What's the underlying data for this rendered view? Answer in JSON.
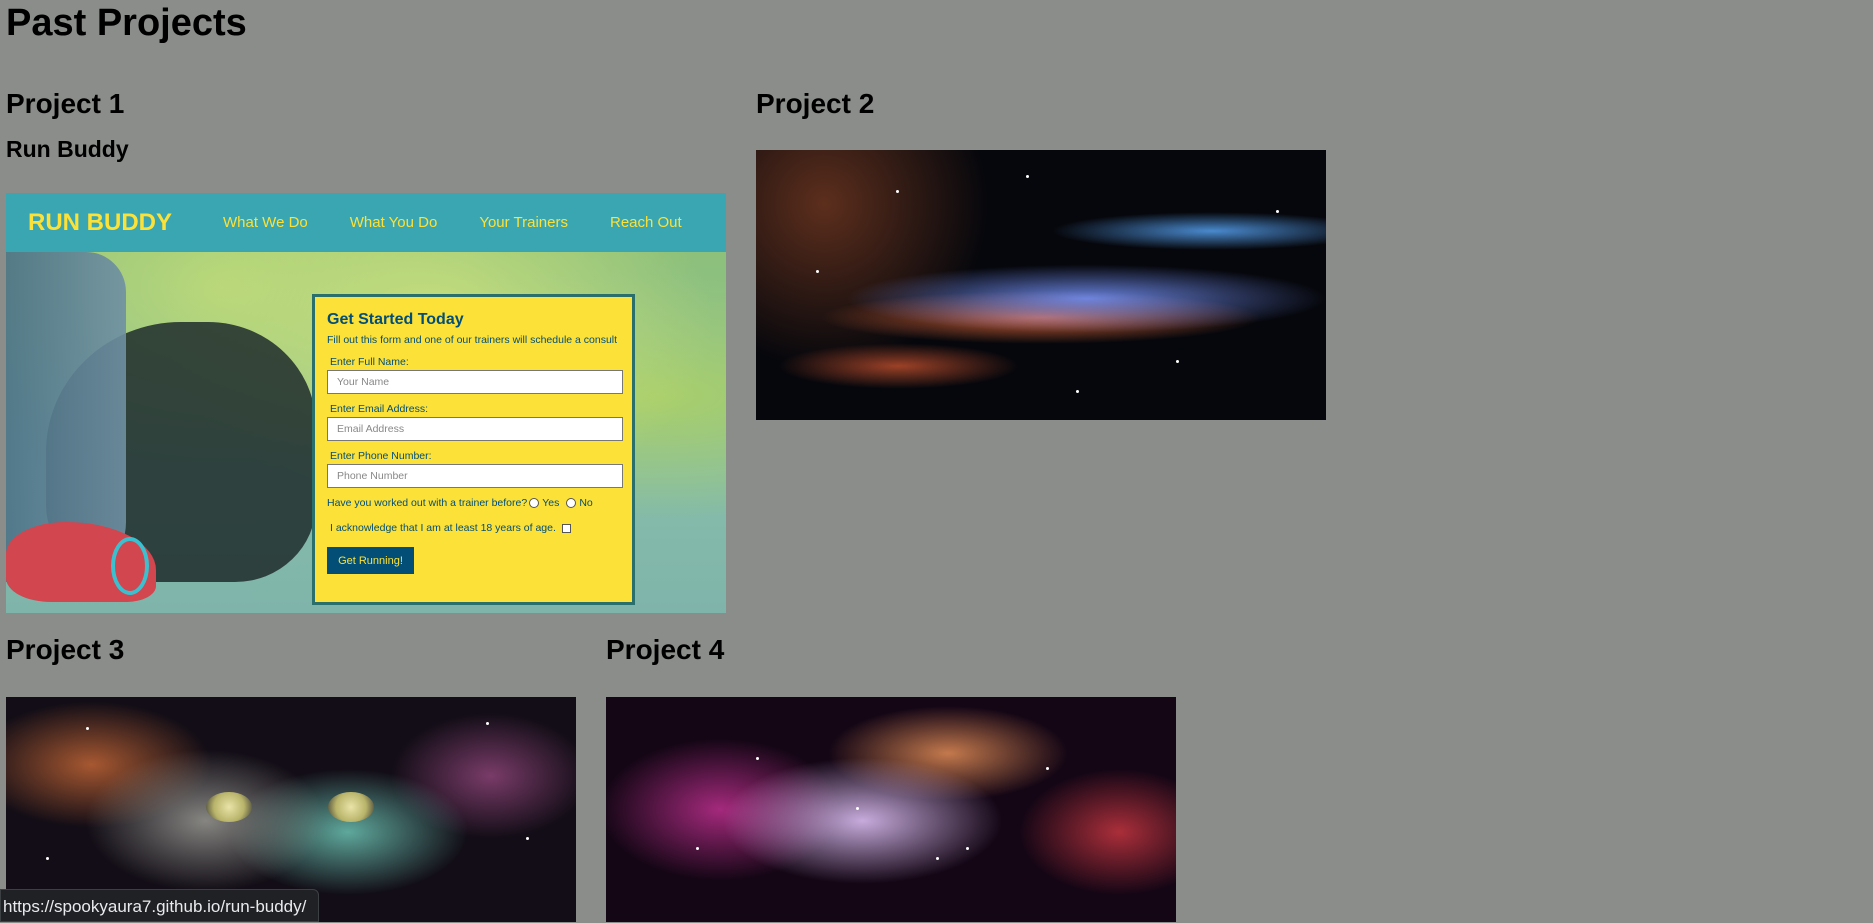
{
  "page_title": "Past Projects",
  "projects": [
    {
      "heading": "Project 1",
      "subtitle": "Run Buddy"
    },
    {
      "heading": "Project 2"
    },
    {
      "heading": "Project 3"
    },
    {
      "heading": "Project 4"
    }
  ],
  "run_buddy": {
    "logo": "RUN BUDDY",
    "nav": [
      "What We Do",
      "What You Do",
      "Your Trainers",
      "Reach Out"
    ],
    "form": {
      "title": "Get Started Today",
      "description": "Fill out this form and one of our trainers will schedule a consult",
      "name_label": "Enter Full Name:",
      "name_placeholder": "Your Name",
      "email_label": "Enter Email Address:",
      "email_placeholder": "Email Address",
      "phone_label": "Enter Phone Number:",
      "phone_placeholder": "Phone Number",
      "trainer_question": "Have you worked out with a trainer before?",
      "yes": "Yes",
      "no": "No",
      "acknowledge": "I acknowledge that I am at least 18 years of age.",
      "button": "Get Running!"
    },
    "colors": {
      "nav_bg": "#39a6b2",
      "accent": "#fce138",
      "text": "#024e76"
    }
  },
  "status_bar_url": "https://spookyaura7.github.io/run-buddy/",
  "colors": {
    "page_bg": "#8a8d89"
  }
}
